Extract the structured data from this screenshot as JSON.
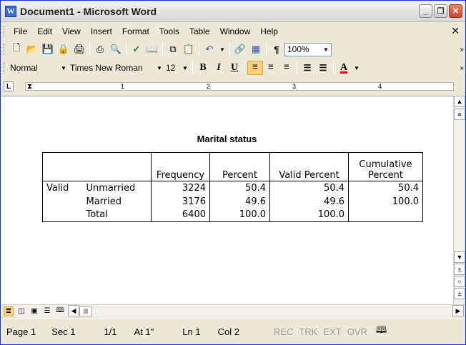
{
  "window": {
    "title": "Document1 - Microsoft Word"
  },
  "menu": [
    "File",
    "Edit",
    "View",
    "Insert",
    "Format",
    "Tools",
    "Table",
    "Window",
    "Help"
  ],
  "toolbar1": {
    "zoom": "100%"
  },
  "toolbar2": {
    "style": "Normal",
    "font": "Times New Roman",
    "size": "12"
  },
  "ruler": {
    "marks": [
      "1",
      "2",
      "3",
      "4"
    ]
  },
  "document": {
    "table_title": "Marital status",
    "headers": {
      "frequency": "Frequency",
      "percent": "Percent",
      "valid_percent": "Valid Percent",
      "cumulative_percent": "Cumulative Percent"
    },
    "row_group": "Valid",
    "rows": [
      {
        "label": "Unmarried",
        "frequency": "3224",
        "percent": "50.4",
        "valid_percent": "50.4",
        "cumulative": "50.4"
      },
      {
        "label": "Married",
        "frequency": "3176",
        "percent": "49.6",
        "valid_percent": "49.6",
        "cumulative": "100.0"
      },
      {
        "label": "Total",
        "frequency": "6400",
        "percent": "100.0",
        "valid_percent": "100.0",
        "cumulative": ""
      }
    ]
  },
  "status": {
    "page": "Page 1",
    "sec": "Sec 1",
    "pages": "1/1",
    "at": "At 1\"",
    "ln": "Ln 1",
    "col": "Col 2",
    "rec": "REC",
    "trk": "TRK",
    "ext": "EXT",
    "ovr": "OVR"
  }
}
